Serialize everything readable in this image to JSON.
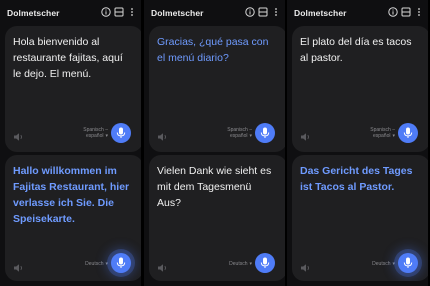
{
  "panes": [
    {
      "title": "Dolmetscher",
      "top": {
        "text": "Hola bienvenido al restaurante fajitas, aquí le dejo. El menú.",
        "lang_line1": "Spanisch –",
        "lang_line2": "español"
      },
      "bottom": {
        "text": "Hallo willkommen im Fajitas Restaurant, hier verlasse ich Sie. Die Speisekarte.",
        "lang_line1": "Deutsch"
      }
    },
    {
      "title": "Dolmetscher",
      "top": {
        "text": "Gracias, ¿qué pasa con el menú diario?",
        "lang_line1": "Spanisch –",
        "lang_line2": "español"
      },
      "bottom": {
        "text": "Vielen Dank wie sieht es mit dem Tagesmenü Aus?",
        "lang_line1": "Deutsch"
      }
    },
    {
      "title": "Dolmetscher",
      "top": {
        "text": "El plato del día es tacos al pastor.",
        "lang_line1": "Spanisch –",
        "lang_line2": "español"
      },
      "bottom": {
        "text": "Das Gericht des Tages ist Tacos al Pastor.",
        "lang_line1": "Deutsch"
      }
    }
  ],
  "icons": {
    "info": "info-icon",
    "split": "split-screen-icon",
    "more": "more-vertical-icon",
    "speaker": "speaker-icon",
    "mic": "microphone-icon",
    "chevron": "chevron-down-icon"
  },
  "colors": {
    "background": "#000000",
    "card": "#1f1f21",
    "accent_text": "#6f9bff",
    "mic_button": "#4f7cf7",
    "text": "#f1f1f1"
  }
}
